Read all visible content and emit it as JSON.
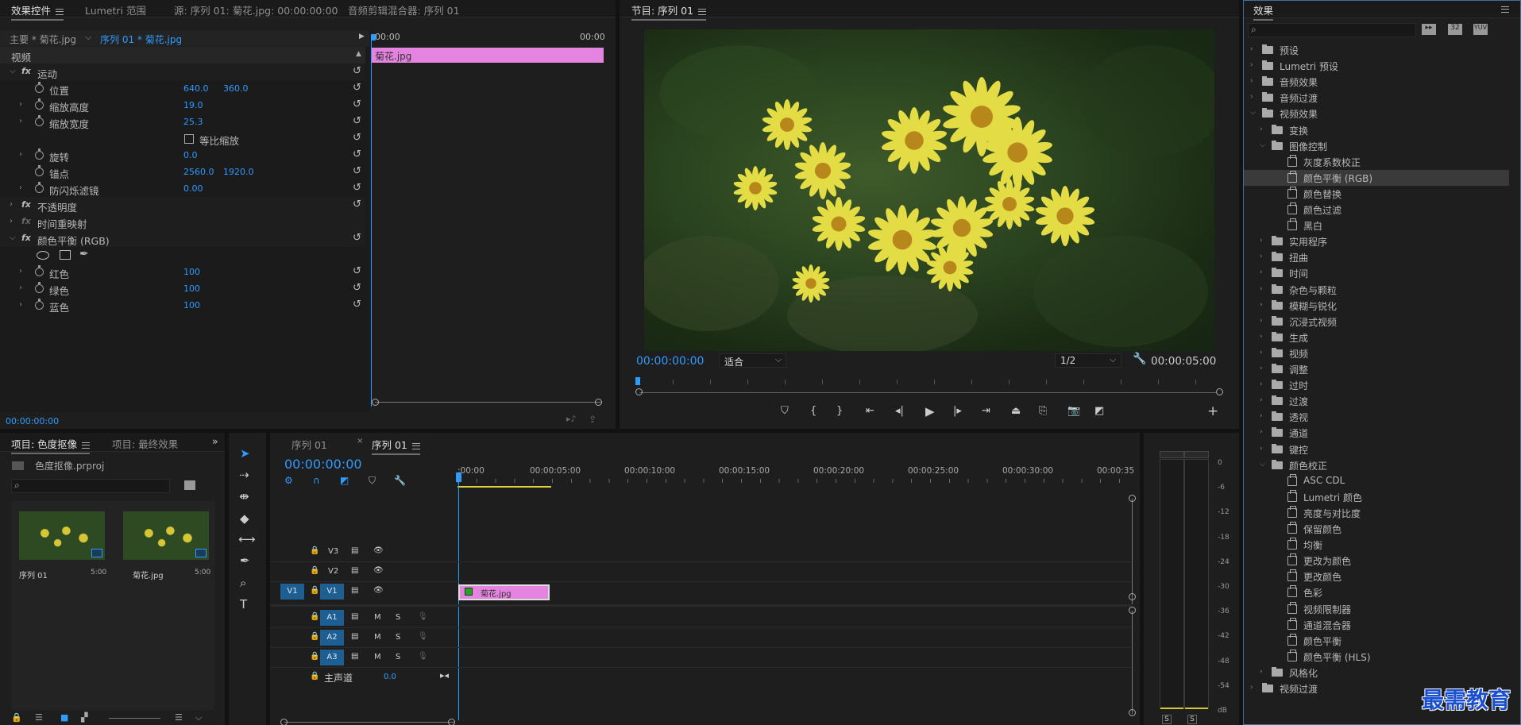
{
  "effect_controls": {
    "tabs": [
      "效果控件",
      "Lumetri 范围",
      "源: 序列 01: 菊花.jpg: 00:00:00:00",
      "音频剪辑混合器: 序列 01"
    ],
    "master_clip": "主要 * 菊花.jpg",
    "sequence_clip": "序列 01 * 菊花.jpg",
    "ruler_start": "00:00",
    "ruler_end": "00:00",
    "clip_name": "菊花.jpg",
    "section_video": "视频",
    "motion": "运动",
    "position_label": "位置",
    "position_x": "640.0",
    "position_y": "360.0",
    "scale_h_label": "缩放高度",
    "scale_h": "19.0",
    "scale_w_label": "缩放宽度",
    "scale_w": "25.3",
    "uniform_label": "等比缩放",
    "rotation_label": "旋转",
    "rotation": "0.0",
    "anchor_label": "锚点",
    "anchor_x": "2560.0",
    "anchor_y": "1920.0",
    "flicker_label": "防闪烁滤镜",
    "flicker": "0.00",
    "opacity": "不透明度",
    "time_remap": "时间重映射",
    "color_balance": "颜色平衡 (RGB)",
    "red_label": "红色",
    "red": "100",
    "green_label": "绿色",
    "green": "100",
    "blue_label": "蓝色",
    "blue": "100",
    "timecode": "00:00:00:00"
  },
  "program": {
    "title": "节目: 序列 01",
    "timecode": "00:00:00:00",
    "fit": "适合",
    "resolution": "1/2",
    "duration": "00:00:05:00"
  },
  "effects": {
    "title": "效果",
    "items": [
      {
        "level": 0,
        "type": "folder",
        "label": "预设",
        "open": false
      },
      {
        "level": 0,
        "type": "folder",
        "label": "Lumetri 预设",
        "open": false
      },
      {
        "level": 0,
        "type": "folder",
        "label": "音频效果",
        "open": false
      },
      {
        "level": 0,
        "type": "folder",
        "label": "音频过渡",
        "open": false
      },
      {
        "level": 0,
        "type": "folder",
        "label": "视频效果",
        "open": true
      },
      {
        "level": 1,
        "type": "folder",
        "label": "变换",
        "open": false
      },
      {
        "level": 1,
        "type": "folder",
        "label": "图像控制",
        "open": true
      },
      {
        "level": 2,
        "type": "effect",
        "label": "灰度系数校正"
      },
      {
        "level": 2,
        "type": "effect",
        "label": "颜色平衡 (RGB)",
        "selected": true
      },
      {
        "level": 2,
        "type": "effect",
        "label": "颜色替换"
      },
      {
        "level": 2,
        "type": "effect",
        "label": "颜色过滤"
      },
      {
        "level": 2,
        "type": "effect",
        "label": "黑白"
      },
      {
        "level": 1,
        "type": "folder",
        "label": "实用程序",
        "open": false
      },
      {
        "level": 1,
        "type": "folder",
        "label": "扭曲",
        "open": false
      },
      {
        "level": 1,
        "type": "folder",
        "label": "时间",
        "open": false
      },
      {
        "level": 1,
        "type": "folder",
        "label": "杂色与颗粒",
        "open": false
      },
      {
        "level": 1,
        "type": "folder",
        "label": "模糊与锐化",
        "open": false
      },
      {
        "level": 1,
        "type": "folder",
        "label": "沉浸式视频",
        "open": false
      },
      {
        "level": 1,
        "type": "folder",
        "label": "生成",
        "open": false
      },
      {
        "level": 1,
        "type": "folder",
        "label": "视频",
        "open": false
      },
      {
        "level": 1,
        "type": "folder",
        "label": "调整",
        "open": false
      },
      {
        "level": 1,
        "type": "folder",
        "label": "过时",
        "open": false
      },
      {
        "level": 1,
        "type": "folder",
        "label": "过渡",
        "open": false
      },
      {
        "level": 1,
        "type": "folder",
        "label": "透视",
        "open": false
      },
      {
        "level": 1,
        "type": "folder",
        "label": "通道",
        "open": false
      },
      {
        "level": 1,
        "type": "folder",
        "label": "键控",
        "open": false
      },
      {
        "level": 1,
        "type": "folder",
        "label": "颜色校正",
        "open": true
      },
      {
        "level": 2,
        "type": "effect",
        "label": "ASC CDL"
      },
      {
        "level": 2,
        "type": "effect",
        "label": "Lumetri 颜色"
      },
      {
        "level": 2,
        "type": "effect",
        "label": "亮度与对比度"
      },
      {
        "level": 2,
        "type": "effect",
        "label": "保留颜色"
      },
      {
        "level": 2,
        "type": "effect",
        "label": "均衡"
      },
      {
        "level": 2,
        "type": "effect",
        "label": "更改为颜色"
      },
      {
        "level": 2,
        "type": "effect",
        "label": "更改颜色"
      },
      {
        "level": 2,
        "type": "effect",
        "label": "色彩"
      },
      {
        "level": 2,
        "type": "effect",
        "label": "视频限制器"
      },
      {
        "level": 2,
        "type": "effect",
        "label": "通道混合器"
      },
      {
        "level": 2,
        "type": "effect",
        "label": "颜色平衡"
      },
      {
        "level": 2,
        "type": "effect",
        "label": "颜色平衡 (HLS)"
      },
      {
        "level": 1,
        "type": "folder",
        "label": "风格化",
        "open": false
      },
      {
        "level": 0,
        "type": "folder",
        "label": "视频过渡",
        "open": false
      }
    ]
  },
  "project": {
    "tabs": [
      "项目: 色度抠像",
      "项目: 最终效果"
    ],
    "file": "色度抠像.prproj",
    "items": [
      {
        "name": "序列 01",
        "dur": "5:00"
      },
      {
        "name": "菊花.jpg",
        "dur": "5:00"
      }
    ]
  },
  "timeline": {
    "tabs": [
      "序列 01",
      "序列 01"
    ],
    "timecode": "00:00:00:00",
    "ticks": [
      ":00:00",
      "00:00:05:00",
      "00:00:10:00",
      "00:00:15:00",
      "00:00:20:00",
      "00:00:25:00",
      "00:00:30:00",
      "00:00:35"
    ],
    "clip": "菊花.jpg",
    "video_tracks": [
      "V3",
      "V2",
      "V1"
    ],
    "audio_tracks": [
      "A1",
      "A2",
      "A3"
    ],
    "source_patch": "V1",
    "master_label": "主声道",
    "master_val": "0.0",
    "m": "M",
    "s": "S"
  },
  "meter": {
    "scale": [
      "0",
      "-6",
      "-12",
      "-18",
      "-24",
      "-30",
      "-36",
      "-42",
      "-48",
      "-54",
      "dB"
    ],
    "solo": "S"
  },
  "watermark": "最需教育"
}
